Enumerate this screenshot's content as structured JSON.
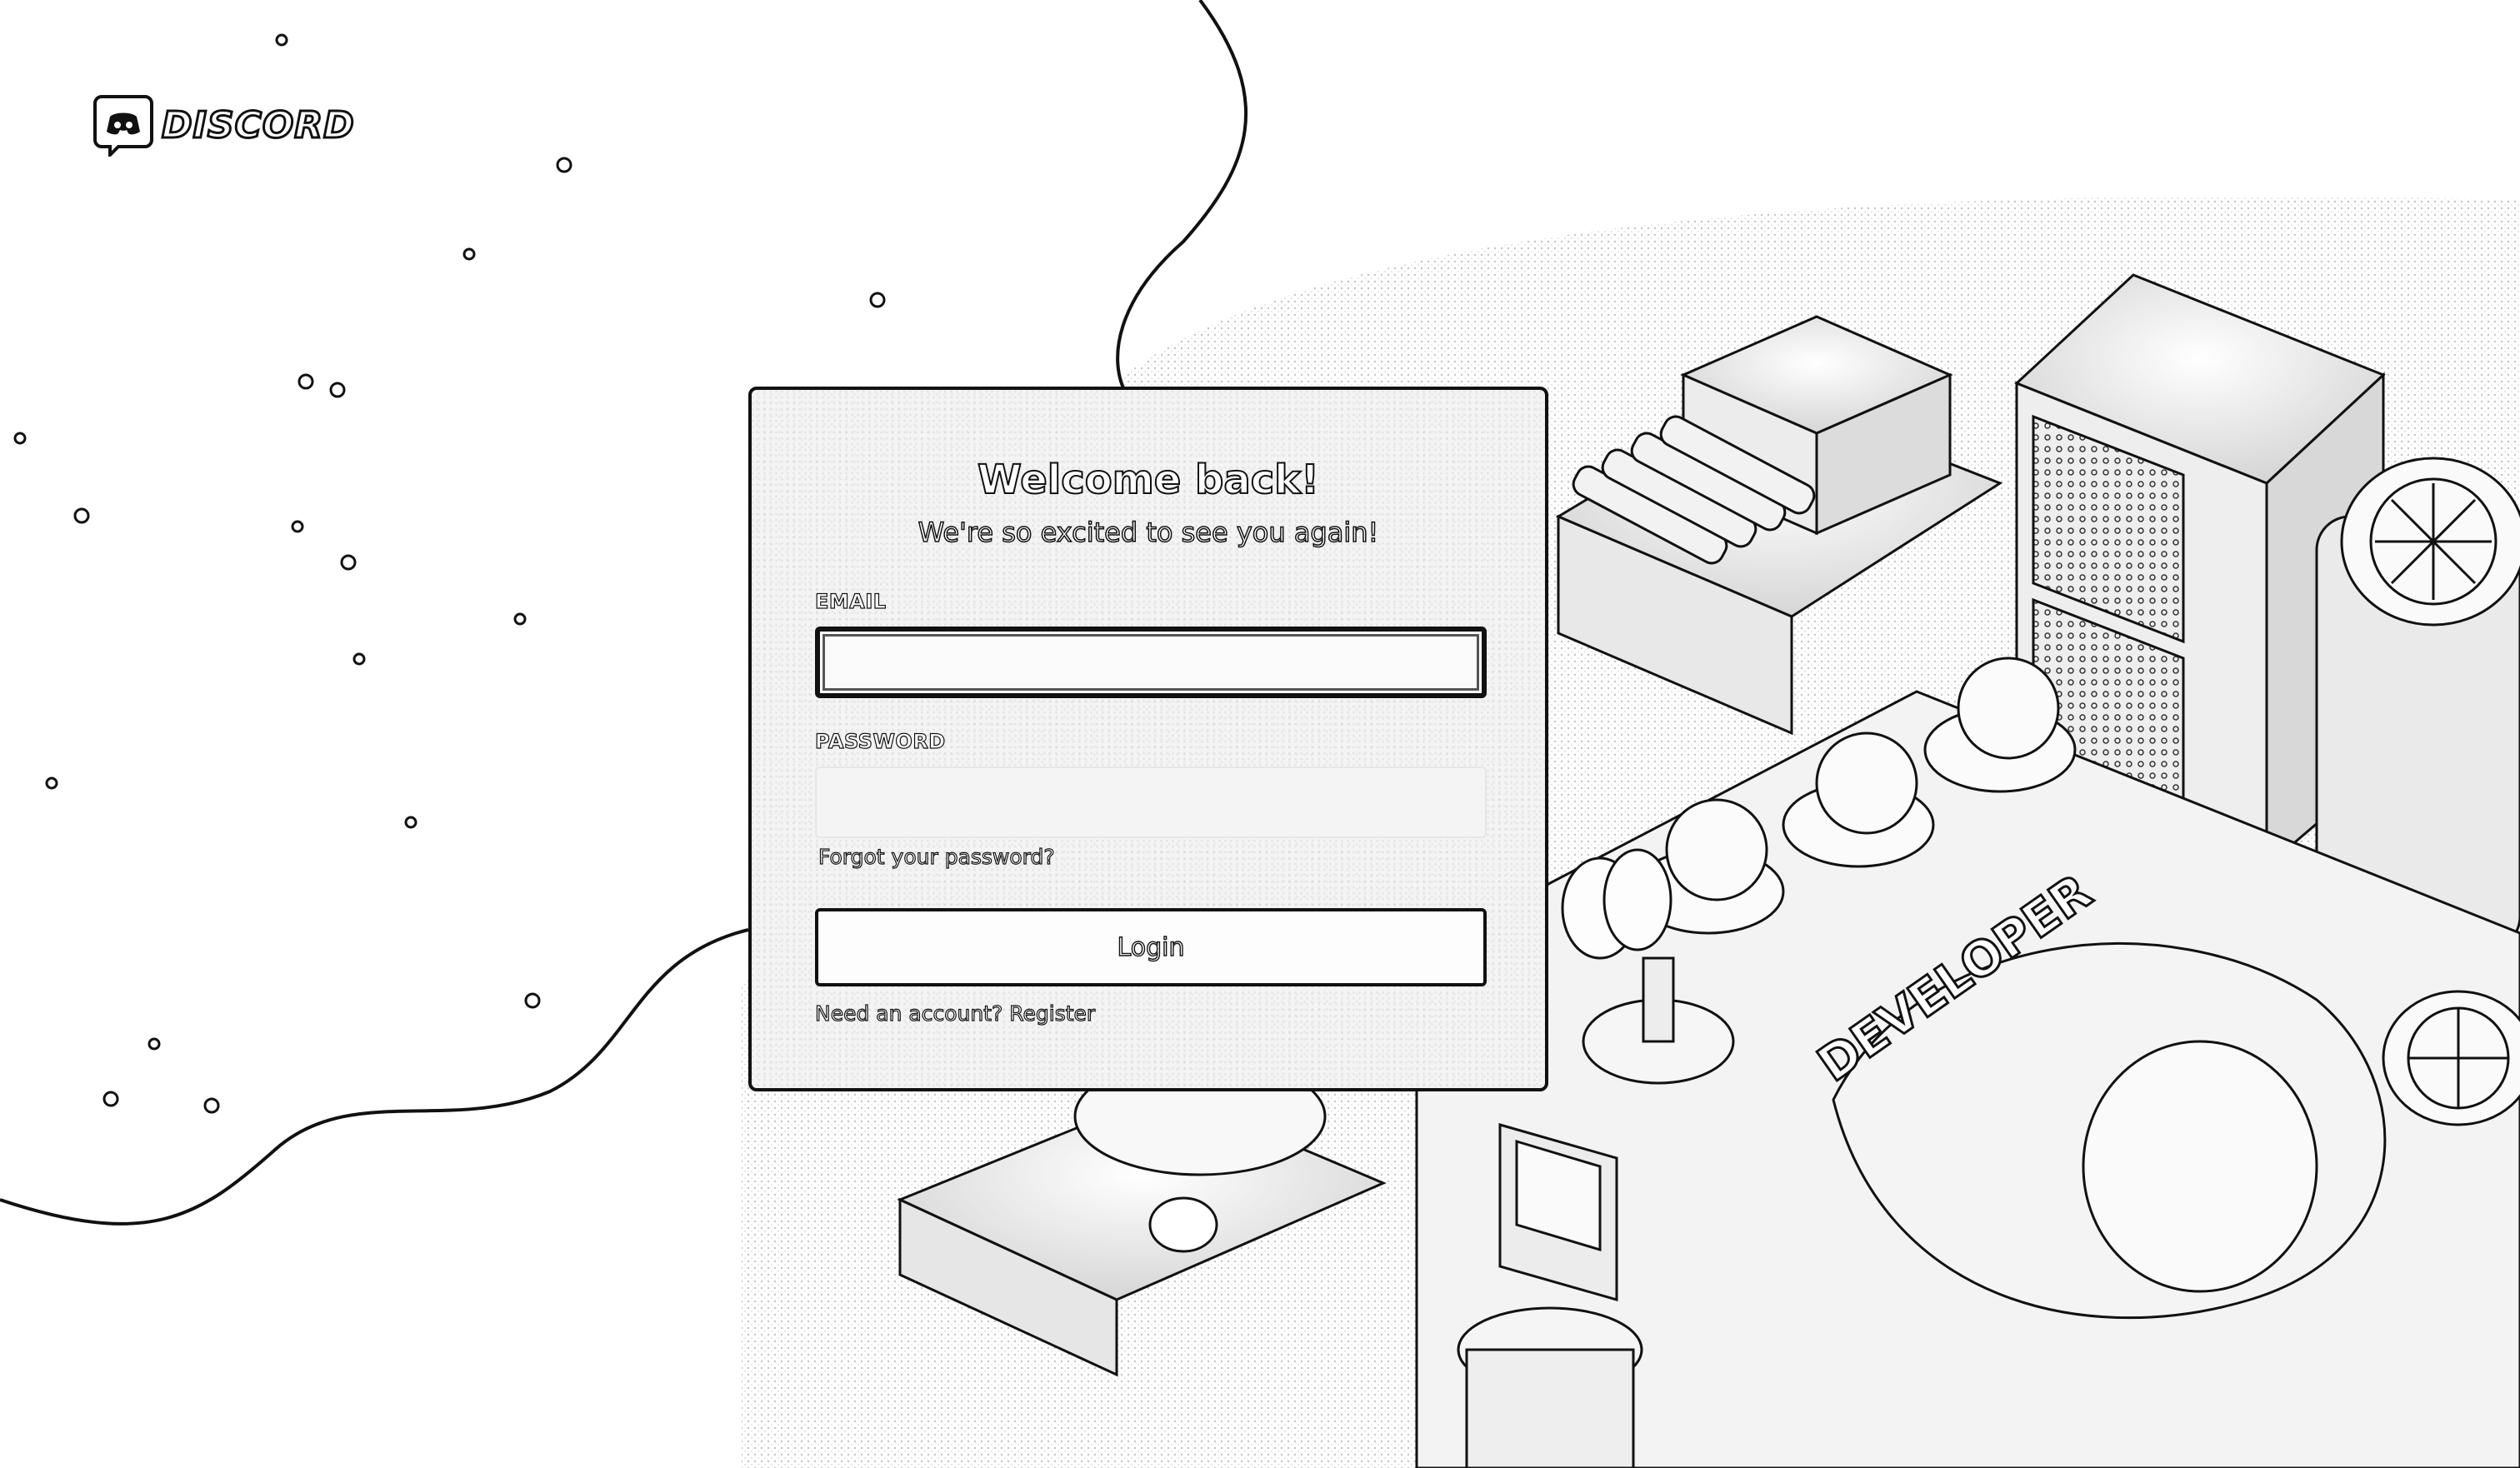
{
  "brand": {
    "name": "DISCORD",
    "logo_icon": "discord-logo-icon"
  },
  "login": {
    "title": "Welcome back!",
    "subtitle": "We're so excited to see you again!",
    "email_label": "EMAIL",
    "email_value": "",
    "password_label": "PASSWORD",
    "password_value": "",
    "forgot_password": "Forgot your password?",
    "login_button": "Login",
    "need_account": "Need an account?",
    "register_link": "Register"
  },
  "colors": {
    "outline": "#111111",
    "card_fill": "#f4f4f4",
    "page_bg": "#ffffff"
  }
}
